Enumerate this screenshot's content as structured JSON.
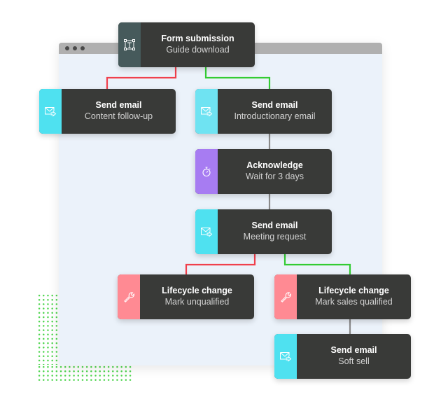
{
  "colors": {
    "branch_no": "#f0404c",
    "branch_yes": "#33cc33",
    "straight": "#8a8a8a",
    "node_body": "#393a38",
    "form_icon_bg": "#465a5b",
    "email_icon_bg": "#4fe1f0",
    "wait_icon_bg": "#a77cf2",
    "lifecycle_icon_bg": "#ff8a93",
    "canvas_bg": "#ebf2fa",
    "window_bar": "#b0b0b0"
  },
  "nodes": {
    "form_submission": {
      "title": "Form submission",
      "subtitle": "Guide download",
      "icon": "text-field-icon"
    },
    "email_content": {
      "title": "Send email",
      "subtitle": "Content follow-up",
      "icon": "email-send-icon"
    },
    "email_intro": {
      "title": "Send email",
      "subtitle": "Introductionary email",
      "icon": "email-send-icon"
    },
    "acknowledge": {
      "title": "Acknowledge",
      "subtitle": "Wait for 3 days",
      "icon": "stopwatch-icon"
    },
    "email_meeting": {
      "title": "Send email",
      "subtitle": "Meeting request",
      "icon": "email-send-icon"
    },
    "lifecycle_unqualified": {
      "title": "Lifecycle change",
      "subtitle": "Mark unqualified",
      "icon": "wrench-icon"
    },
    "lifecycle_sales": {
      "title": "Lifecycle change",
      "subtitle": "Mark sales qualified",
      "icon": "wrench-icon"
    },
    "email_soft": {
      "title": "Send email",
      "subtitle": "Soft sell",
      "icon": "email-send-icon"
    }
  },
  "edges": [
    {
      "from": "form_submission",
      "to": "email_content",
      "type": "no"
    },
    {
      "from": "form_submission",
      "to": "email_intro",
      "type": "yes"
    },
    {
      "from": "email_intro",
      "to": "acknowledge",
      "type": "straight"
    },
    {
      "from": "acknowledge",
      "to": "email_meeting",
      "type": "straight"
    },
    {
      "from": "email_meeting",
      "to": "lifecycle_unqualified",
      "type": "no"
    },
    {
      "from": "email_meeting",
      "to": "lifecycle_sales",
      "type": "yes"
    },
    {
      "from": "lifecycle_sales",
      "to": "email_soft",
      "type": "straight"
    }
  ]
}
